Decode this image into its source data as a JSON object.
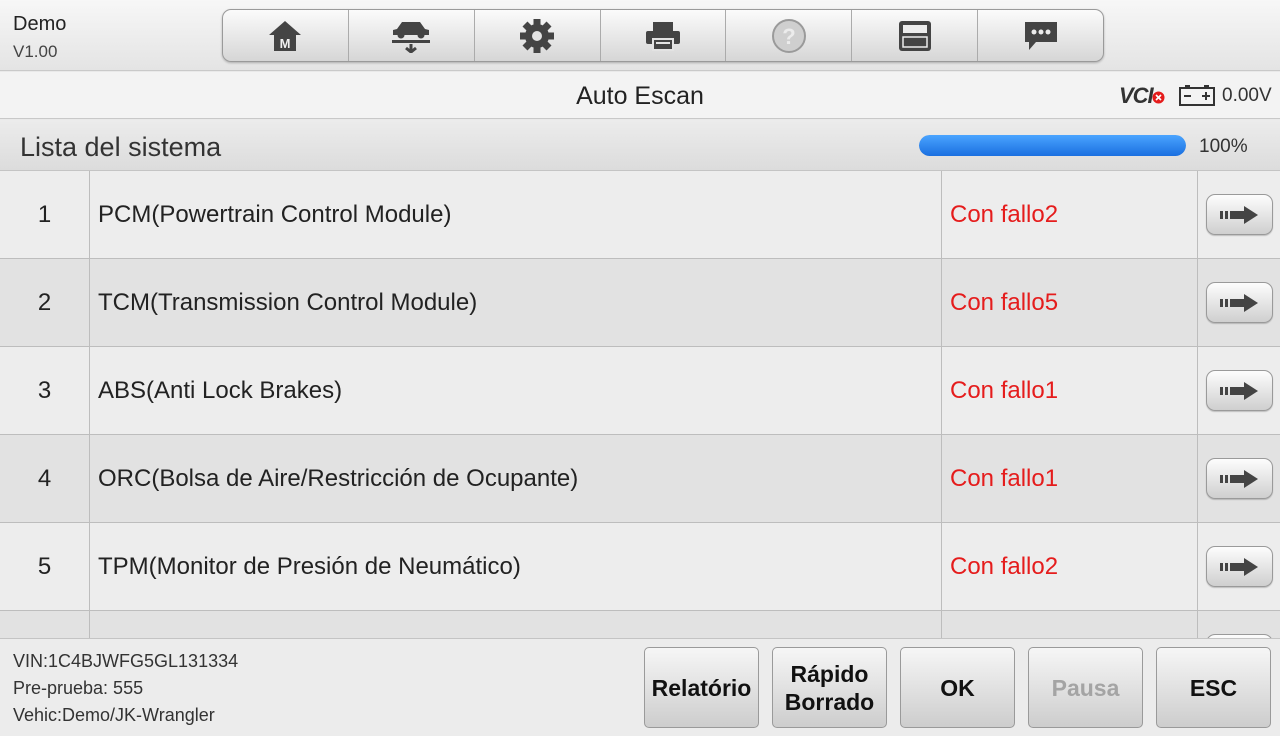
{
  "app": {
    "name": "Demo",
    "version": "V1.00"
  },
  "toolbar": {
    "buttons": [
      {
        "icon": "home-icon"
      },
      {
        "icon": "vehicle-lift-icon"
      },
      {
        "icon": "gear-icon"
      },
      {
        "icon": "printer-icon"
      },
      {
        "icon": "help-icon"
      },
      {
        "icon": "save-icon"
      },
      {
        "icon": "chat-icon"
      }
    ]
  },
  "titlebar": {
    "title": "Auto Escan",
    "vci_label": "VCI",
    "voltage": "0.00V"
  },
  "section": {
    "title": "Lista del sistema",
    "progress": 1.0,
    "progress_text": "100%"
  },
  "systems": [
    {
      "num": "1",
      "name": "PCM(Powertrain Control Module)",
      "status": "Con fallo2"
    },
    {
      "num": "2",
      "name": "TCM(Transmission Control Module)",
      "status": "Con fallo5"
    },
    {
      "num": "3",
      "name": "ABS(Anti Lock Brakes)",
      "status": "Con fallo1"
    },
    {
      "num": "4",
      "name": "ORC(Bolsa de Aire/Restricción de Ocupante)",
      "status": "Con fallo1"
    },
    {
      "num": "5",
      "name": "TPM(Monitor de Presión de Neumático)",
      "status": "Con fallo2"
    }
  ],
  "footer": {
    "vin": "VIN:1C4BJWFG5GL131334",
    "pretest": "Pre-prueba: 555",
    "vehicle": "Vehic:Demo/JK-Wrangler",
    "buttons": {
      "report": "Relatório",
      "quick_erase_1": "Rápido",
      "quick_erase_2": "Borrado",
      "ok": "OK",
      "pause": "Pausa",
      "esc": "ESC"
    }
  },
  "colors": {
    "fault": "#e51c1c",
    "progress": "#1a6fe0"
  }
}
